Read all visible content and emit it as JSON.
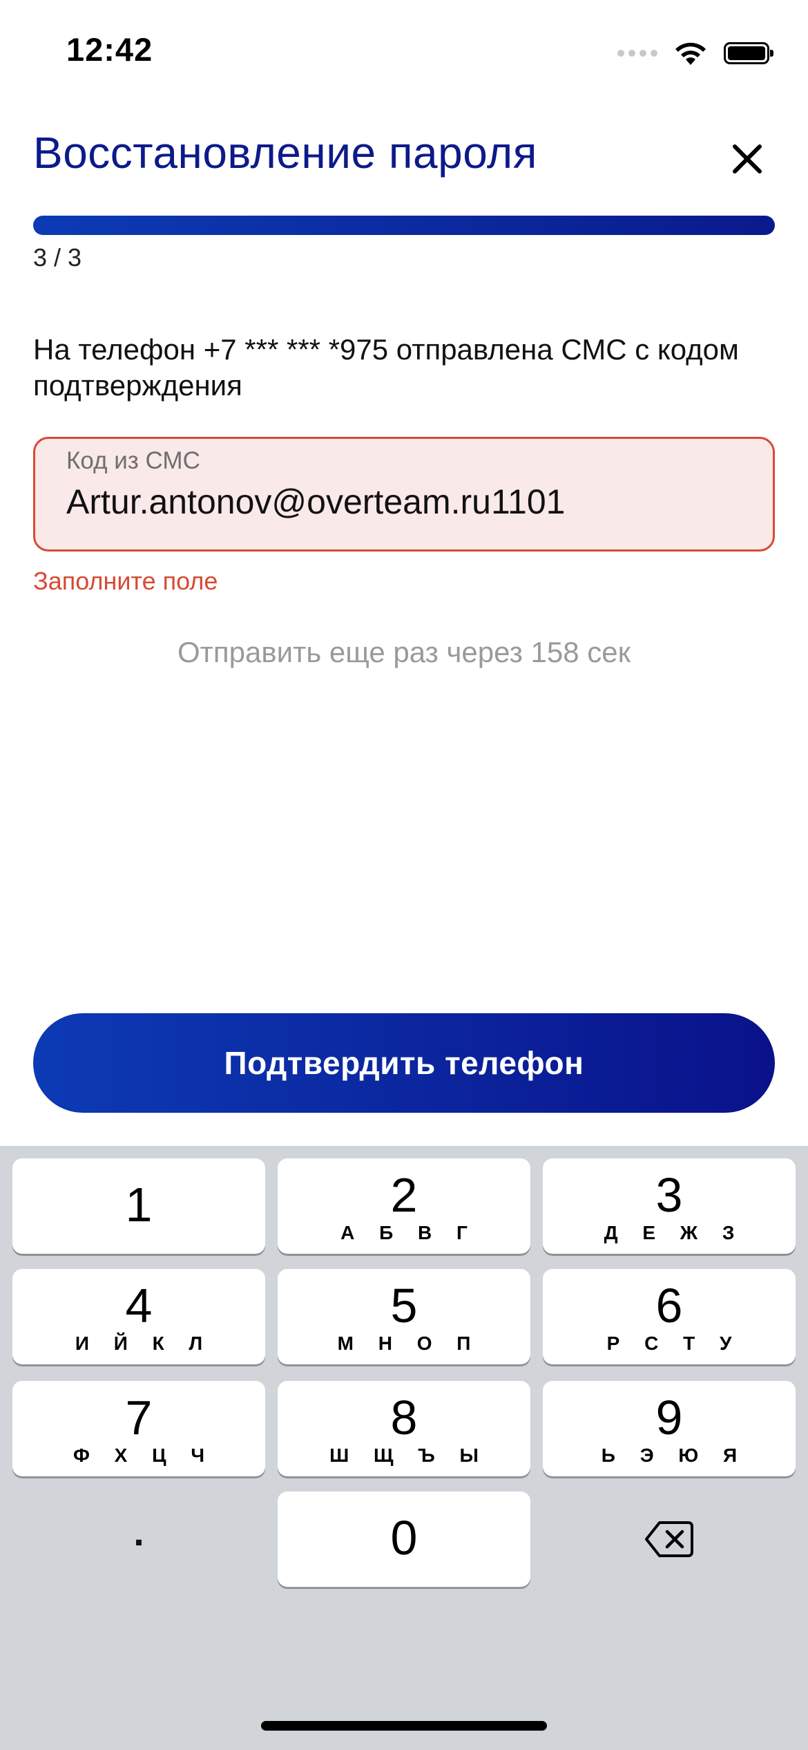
{
  "status_bar": {
    "time": "12:42",
    "icons": [
      "signal-icon",
      "wifi-icon",
      "battery-icon"
    ]
  },
  "header": {
    "title": "Восстановление пароля",
    "close_icon": "close-icon"
  },
  "progress": {
    "fraction": 1.0,
    "label": "3 / 3"
  },
  "message": "На телефон +7 *** *** *975 отправлена СМС с кодом подтверждения",
  "sms_field": {
    "label": "Код из СМС",
    "value": "Artur.antonov@overteam.ru1101"
  },
  "error_text": "Заполните поле",
  "resend_text": "Отправить еще раз через 158 сек",
  "confirm_button": "Подтвердить телефон",
  "keypad": {
    "keys": [
      {
        "digit": "1",
        "letters": ""
      },
      {
        "digit": "2",
        "letters": "А Б В Г"
      },
      {
        "digit": "3",
        "letters": "Д Е Ж З"
      },
      {
        "digit": "4",
        "letters": "И Й К Л"
      },
      {
        "digit": "5",
        "letters": "М Н О П"
      },
      {
        "digit": "6",
        "letters": "Р С Т У"
      },
      {
        "digit": "7",
        "letters": "Ф Х Ц Ч"
      },
      {
        "digit": "8",
        "letters": "Ш Щ Ъ Ы"
      },
      {
        "digit": "9",
        "letters": "Ь Э Ю Я"
      },
      {
        "digit": "0",
        "letters": ""
      }
    ],
    "dot_key": ".",
    "delete_icon": "backspace-icon"
  },
  "colors": {
    "accent": "#0c1a8a",
    "error": "#d84a35",
    "field_bg": "#f9e9e8",
    "keyboard_bg": "#d1d4d9"
  }
}
